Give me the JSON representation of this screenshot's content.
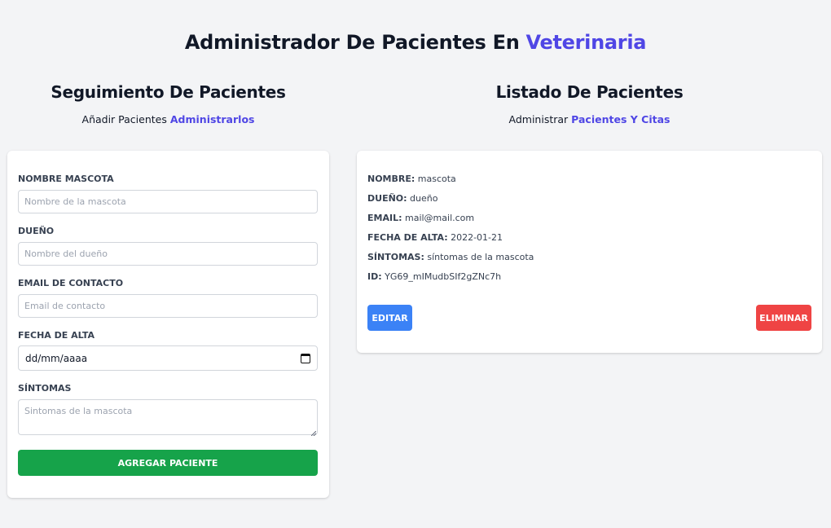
{
  "header": {
    "title_main": "Administrador De Pacientes En",
    "title_accent": "Veterinaria"
  },
  "form_section": {
    "heading": "Seguimiento De Pacientes",
    "subtitle_text": "Añadir Pacientes",
    "subtitle_accent": "Administrarlos",
    "fields": {
      "pet_name": {
        "label": "Nombre Mascota",
        "placeholder": "Nombre de la mascota",
        "value": ""
      },
      "owner": {
        "label": "Dueño",
        "placeholder": "Nombre del dueño",
        "value": ""
      },
      "email": {
        "label": "Email de Contacto",
        "placeholder": "Email de contacto",
        "value": ""
      },
      "date": {
        "label": "Fecha de Alta",
        "value": "dd/mm/aaaa"
      },
      "symptoms": {
        "label": "Síntomas",
        "placeholder": "Sintomas de la mascota",
        "value": ""
      }
    },
    "submit_label": "Agregar Paciente"
  },
  "list_section": {
    "heading": "Listado De Pacientes",
    "subtitle_text": "Administrar",
    "subtitle_accent": "Pacientes Y Citas",
    "patients": [
      {
        "name_label": "Nombre:",
        "name": "mascota",
        "owner_label": "Dueño:",
        "owner": "dueño",
        "email_label": "Email:",
        "email": "mail@mail.com",
        "date_label": "Fecha de Alta:",
        "date": "2022-01-21",
        "symptoms_label": "Síntomas:",
        "symptoms": "síntomas de la mascota",
        "id_label": "ID:",
        "id": "YG69_mIMudbSIf2gZNc7h",
        "edit_label": "Editar",
        "delete_label": "Eliminar"
      }
    ]
  },
  "icons": {
    "date_picker": "calendar-icon"
  },
  "colors": {
    "accent": "#4f46e5",
    "submit": "#16a34a",
    "edit": "#3b82f6",
    "delete": "#ef4444",
    "background": "#f3f4f6"
  }
}
